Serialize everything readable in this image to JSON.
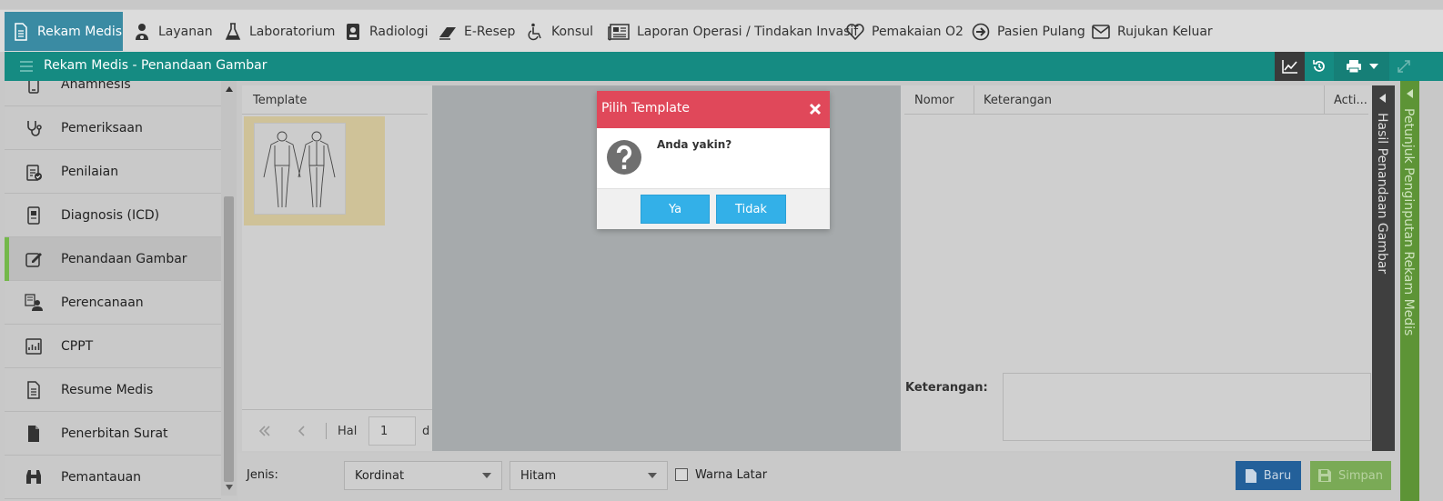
{
  "tabs": [
    {
      "label": "Rekam Medis",
      "icon": "document-icon",
      "active": true
    },
    {
      "label": "Layanan",
      "icon": "user-doctor-icon"
    },
    {
      "label": "Laboratorium",
      "icon": "flask-icon"
    },
    {
      "label": "Radiologi",
      "icon": "id-badge-icon"
    },
    {
      "label": "E-Resep",
      "icon": "eraser-icon"
    },
    {
      "label": "Konsul",
      "icon": "wheelchair-icon"
    },
    {
      "label": "Laporan Operasi / Tindakan Invasif",
      "icon": "newspaper-icon"
    },
    {
      "label": "Pemakaian O2",
      "icon": "heart-icon"
    },
    {
      "label": "Pasien Pulang",
      "icon": "arrow-circle-icon"
    },
    {
      "label": "Rujukan Keluar",
      "icon": "envelope-icon"
    }
  ],
  "titlebar": {
    "title": "Rekam Medis - Penandaan Gambar"
  },
  "sidebar": {
    "items": [
      {
        "label": "Anamnesis",
        "icon": "mobile-icon"
      },
      {
        "label": "Pemeriksaan",
        "icon": "stethoscope-icon"
      },
      {
        "label": "Penilaian",
        "icon": "clipboard-check-icon"
      },
      {
        "label": "Diagnosis (ICD)",
        "icon": "device-file-icon"
      },
      {
        "label": "Penandaan Gambar",
        "icon": "edit-icon",
        "active": true
      },
      {
        "label": "Perencanaan",
        "icon": "user-plan-icon"
      },
      {
        "label": "CPPT",
        "icon": "chart-report-icon"
      },
      {
        "label": "Resume Medis",
        "icon": "file-text-icon"
      },
      {
        "label": "Penerbitan Surat",
        "icon": "file-icon"
      },
      {
        "label": "Pemantauan",
        "icon": "binoculars-icon"
      }
    ]
  },
  "template_panel": {
    "header": "Template",
    "hal_label": "Hal",
    "hal_value": "1",
    "trailing": "d"
  },
  "result_table": {
    "col_nomor": "Nomor",
    "col_keterangan": "Keterangan",
    "col_action": "Acti...",
    "keterangan_label": "Keterangan:"
  },
  "side_panels": {
    "hasil": "Hasil Penandaan Gambar",
    "petunjuk": "Petunjuk Penginputan Rekam Medis"
  },
  "bottom": {
    "jenis_label": "Jenis:",
    "jenis_value": "Kordinat",
    "warna_value": "Hitam",
    "warna_latar_label": "Warna Latar",
    "baru_label": "Baru",
    "simpan_label": "Simpan"
  },
  "modal": {
    "title": "Pilih Template",
    "message": "Anda yakin?",
    "yes_label": "Ya",
    "no_label": "Tidak"
  },
  "colors": {
    "teal": "#158b82",
    "active_tab": "#3a8ba3",
    "modal_header": "#e0485a",
    "modal_button": "#33b0e8",
    "baru": "#23609a",
    "simpan": "#7aaa56",
    "sidebar_active": "#74b84a"
  }
}
